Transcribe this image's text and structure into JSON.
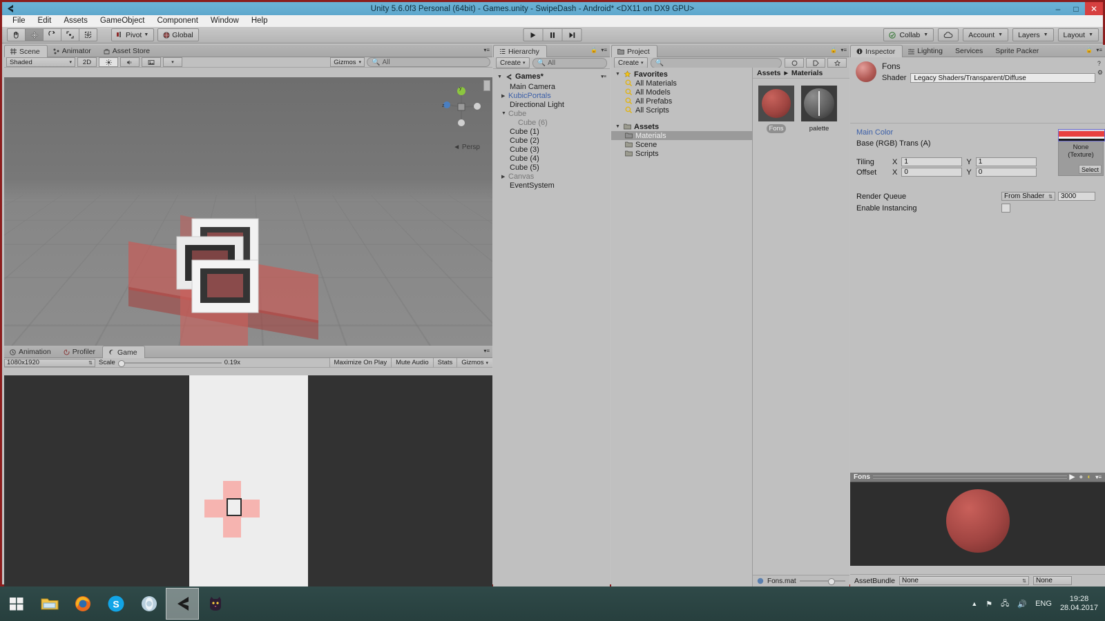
{
  "window": {
    "title": "Unity 5.6.0f3 Personal (64bit) - Games.unity - SwipeDash - Android* <DX11 on DX9 GPU>",
    "minimize": "–",
    "maximize": "□",
    "close": "✕"
  },
  "menu": [
    "File",
    "Edit",
    "Assets",
    "GameObject",
    "Component",
    "Window",
    "Help"
  ],
  "toolbar": {
    "tools": [
      "hand-tool",
      "move-tool",
      "rotate-tool",
      "scale-tool",
      "rect-tool"
    ],
    "pivot_label": "Pivot",
    "global_label": "Global",
    "play": "▶",
    "pause": "❚❚",
    "step": "▶❙",
    "collab_label": "Collab",
    "cloud_label": "",
    "account_label": "Account",
    "layers_label": "Layers",
    "layout_label": "Layout"
  },
  "scene": {
    "tabs": [
      {
        "label": "Scene",
        "icon": "scene-icon",
        "active": true
      },
      {
        "label": "Animator",
        "icon": "animator-icon",
        "active": false
      },
      {
        "label": "Asset Store",
        "icon": "store-icon",
        "active": false
      }
    ],
    "draw_mode": "Shaded",
    "mode_2d": "2D",
    "lighting_icon": "☀",
    "audio_icon": "🔊",
    "effects_icon": "▣",
    "gizmos_label": "Gizmos",
    "search_placeholder": "All",
    "persp_label": "Persp",
    "axis_x": "x",
    "axis_y": "y",
    "axis_z": "z"
  },
  "game": {
    "tabs": [
      {
        "label": "Animation",
        "icon": "animation-icon",
        "active": false
      },
      {
        "label": "Profiler",
        "icon": "profiler-icon",
        "active": false
      },
      {
        "label": "Game",
        "icon": "game-icon",
        "active": true
      }
    ],
    "resolution": "1080x1920",
    "scale_label": "Scale",
    "scale_value": "0.19x",
    "maximize_label": "Maximize On Play",
    "mute_label": "Mute Audio",
    "stats_label": "Stats",
    "gizmos_label": "Gizmos"
  },
  "hierarchy": {
    "tab_label": "Hierarchy",
    "create_label": "Create",
    "search_placeholder": "All",
    "scene_name": "Games*",
    "items": [
      {
        "label": "Main Camera",
        "indent": 1,
        "arrow": false,
        "style": "normal"
      },
      {
        "label": "KubicPortals",
        "indent": 1,
        "arrow": true,
        "style": "blue"
      },
      {
        "label": "Directional Light",
        "indent": 1,
        "arrow": false,
        "style": "normal"
      },
      {
        "label": "Cube",
        "indent": 1,
        "arrow": true,
        "style": "dim"
      },
      {
        "label": "Cube (6)",
        "indent": 2,
        "arrow": false,
        "style": "dim"
      },
      {
        "label": "Cube (1)",
        "indent": 1,
        "arrow": false,
        "style": "normal"
      },
      {
        "label": "Cube (2)",
        "indent": 1,
        "arrow": false,
        "style": "normal"
      },
      {
        "label": "Cube (3)",
        "indent": 1,
        "arrow": false,
        "style": "normal"
      },
      {
        "label": "Cube (4)",
        "indent": 1,
        "arrow": false,
        "style": "normal"
      },
      {
        "label": "Cube (5)",
        "indent": 1,
        "arrow": false,
        "style": "normal"
      },
      {
        "label": "Canvas",
        "indent": 1,
        "arrow": true,
        "style": "dim"
      },
      {
        "label": "EventSystem",
        "indent": 1,
        "arrow": false,
        "style": "normal"
      }
    ]
  },
  "project": {
    "tab_label": "Project",
    "create_label": "Create",
    "search_placeholder": "",
    "favorites_label": "Favorites",
    "favorites": [
      "All Materials",
      "All Models",
      "All Prefabs",
      "All Scripts"
    ],
    "assets_label": "Assets",
    "folders": [
      {
        "label": "Materials",
        "selected": true
      },
      {
        "label": "Scene",
        "selected": false
      },
      {
        "label": "Scripts",
        "selected": false
      }
    ],
    "breadcrumb": [
      "Assets",
      "Materials"
    ],
    "assets": [
      {
        "name": "Fons",
        "selected": true,
        "kind": "material-red"
      },
      {
        "name": "palette",
        "selected": false,
        "kind": "material-dark"
      }
    ],
    "status_file": "Fons.mat"
  },
  "inspector": {
    "tabs": [
      {
        "label": "Inspector",
        "icon": "inspector-icon",
        "active": true
      },
      {
        "label": "Lighting",
        "icon": "lighting-icon",
        "active": false
      },
      {
        "label": "Services",
        "icon": "services-icon",
        "active": false
      },
      {
        "label": "Sprite Packer",
        "icon": "sprite-packer-icon",
        "active": false
      }
    ],
    "material_name": "Fons",
    "shader_label": "Shader",
    "shader_value": "Legacy Shaders/Transparent/Diffuse",
    "main_color_label": "Main Color",
    "base_label": "Base (RGB) Trans (A)",
    "texture_none_line1": "None",
    "texture_none_line2": "(Texture)",
    "select_label": "Select",
    "tiling_label": "Tiling",
    "offset_label": "Offset",
    "x_label": "X",
    "y_label": "Y",
    "tiling_x": "1",
    "tiling_y": "1",
    "offset_x": "0",
    "offset_y": "0",
    "render_queue_label": "Render Queue",
    "render_queue_mode": "From Shader",
    "render_queue_value": "3000",
    "enable_instancing_label": "Enable Instancing",
    "preview_title": "Fons",
    "assetbundle_label": "AssetBundle",
    "assetbundle_value": "None",
    "assetbundle_variant": "None"
  },
  "taskbar": {
    "apps": [
      {
        "name": "start-button",
        "glyph": "⊞"
      },
      {
        "name": "file-explorer-icon",
        "glyph": "🗂"
      },
      {
        "name": "firefox-icon",
        "glyph": "🦊"
      },
      {
        "name": "skype-icon",
        "glyph": "S"
      },
      {
        "name": "opera-icon",
        "glyph": "◎"
      },
      {
        "name": "unity-icon",
        "glyph": "◁"
      },
      {
        "name": "cat-app-icon",
        "glyph": "🐱"
      }
    ],
    "language": "ENG",
    "time": "19:28",
    "date": "28.04.2017"
  },
  "colors": {
    "accent_blue": "#3a5ea8",
    "panel_bg": "#c0c0c0",
    "title_bg": "#6bb3d6",
    "material_red": "#a14542"
  }
}
